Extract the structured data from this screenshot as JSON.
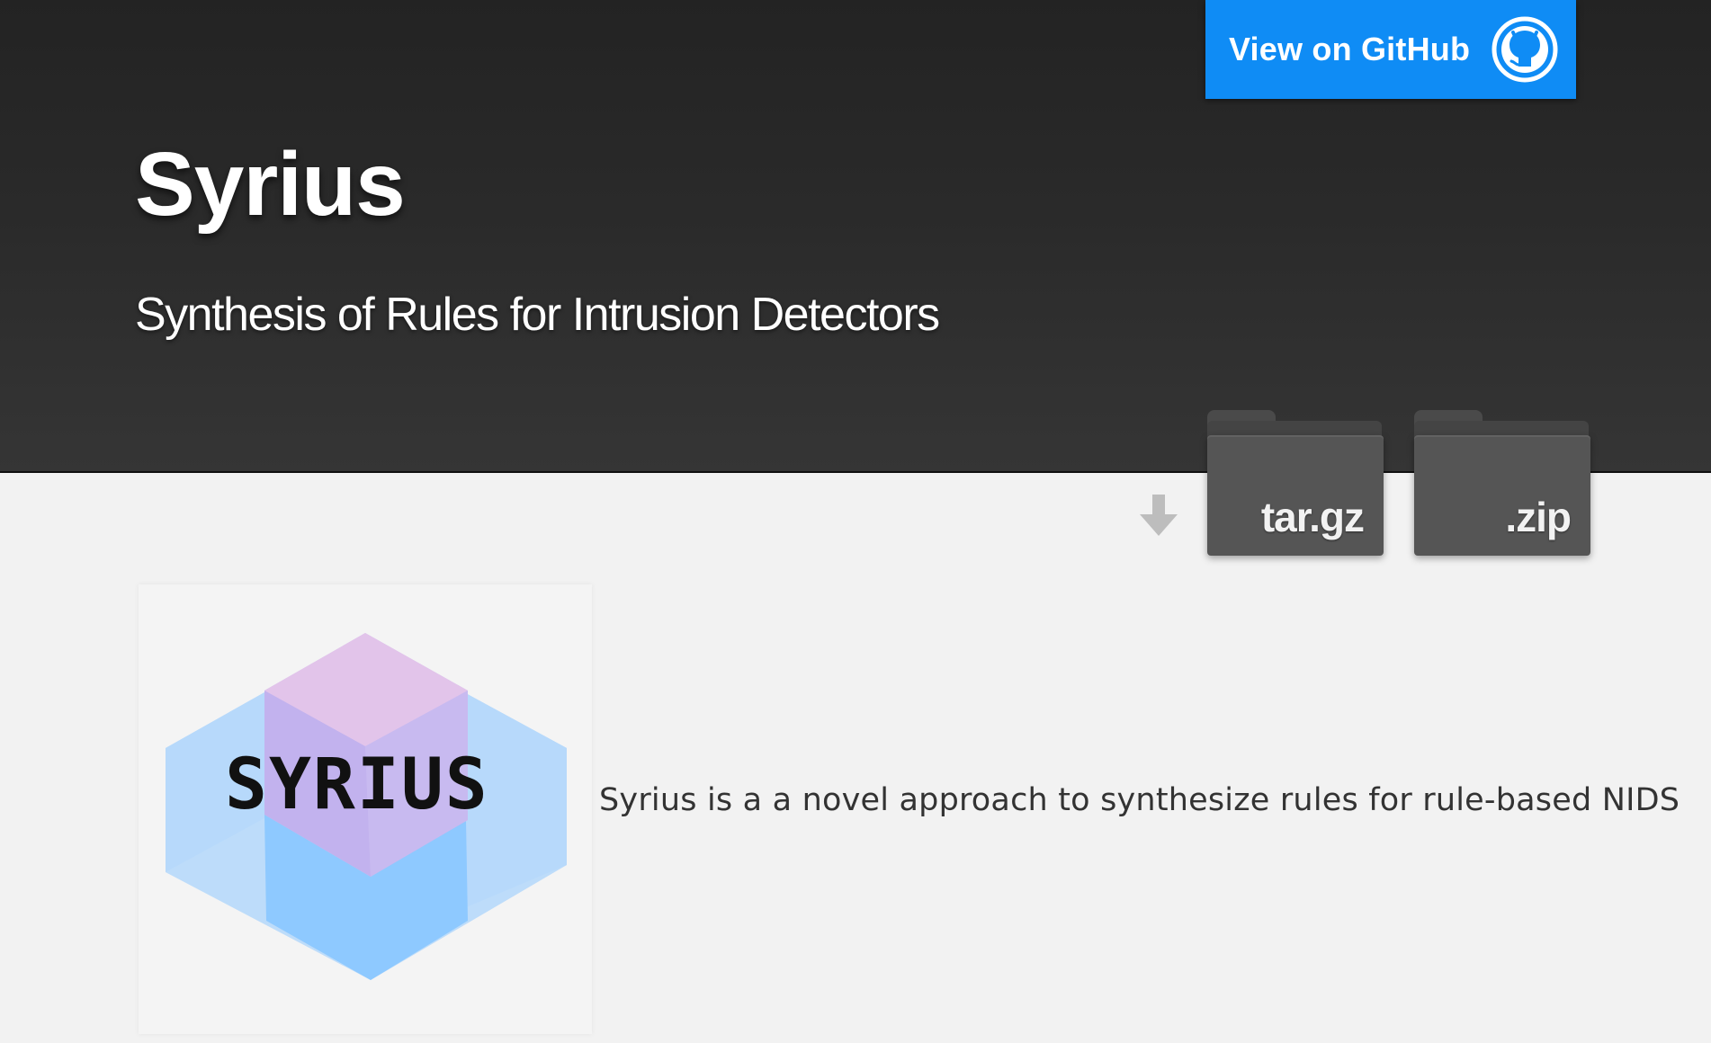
{
  "header": {
    "title": "Syrius",
    "tagline": "Synthesis of Rules for Intrusion Detectors",
    "github_button_label": "View on GitHub"
  },
  "downloads": {
    "arrow_icon": "down-arrow-icon",
    "tar_label": "tar.gz",
    "zip_label": ".zip"
  },
  "main": {
    "logo_text": "SYRIUS",
    "description": "Syrius is a a novel approach to synthesize rules for rule-based NIDS"
  },
  "colors": {
    "header_bg": "#2a2a2a",
    "github_blue": "#0f8cf5",
    "page_bg": "#f2f2f2",
    "folder_gray": "#555555",
    "logo_blue": "#8ec9ff",
    "logo_purple": "#c9b6ef"
  }
}
